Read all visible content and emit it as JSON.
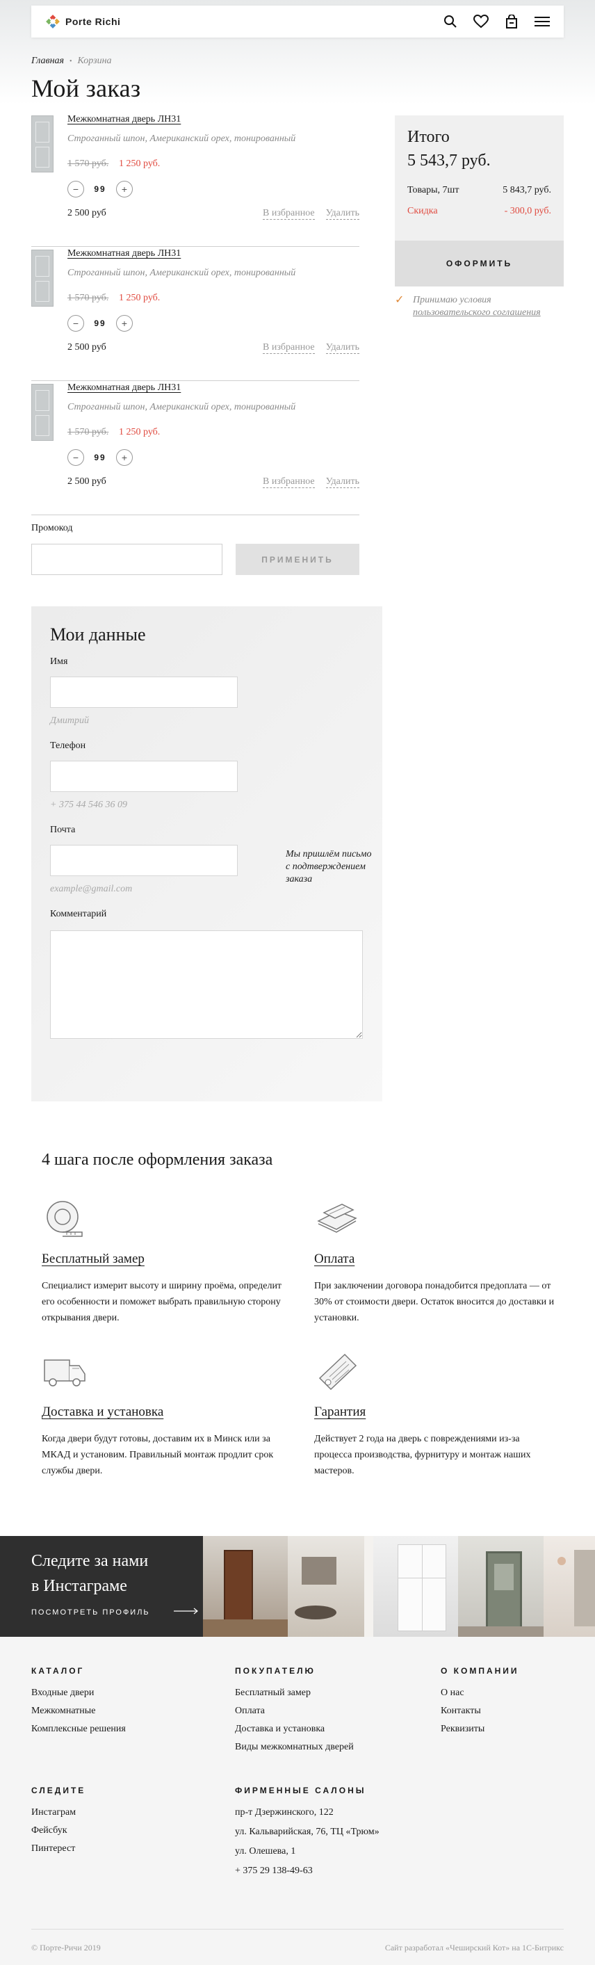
{
  "header": {
    "logo_text": "Porte Richi",
    "icons": [
      "search-icon",
      "heart-icon",
      "bag-icon",
      "menu-icon"
    ]
  },
  "breadcrumb": {
    "home": "Главная",
    "current": "Корзина"
  },
  "page_title": "Мой заказ",
  "cart": {
    "items": [
      {
        "title": "Межкомнатная дверь ЛН31",
        "description": "Строганный шпон, Американский орех, тонированный",
        "old_price": "1 570 руб.",
        "new_price": "1 250 руб.",
        "minus": "−",
        "quantity": "99",
        "plus": "+",
        "total": "2 500 руб",
        "favorite_label": "В избранное",
        "delete_label": "Удалить"
      },
      {
        "title": "Межкомнатная дверь ЛН31",
        "description": "Строганный шпон, Американский орех, тонированный",
        "old_price": "1 570 руб.",
        "new_price": "1 250 руб.",
        "minus": "−",
        "quantity": "99",
        "plus": "+",
        "total": "2 500 руб",
        "favorite_label": "В избранное",
        "delete_label": "Удалить"
      },
      {
        "title": "Межкомнатная дверь ЛН31",
        "description": "Строганный шпон, Американский орех, тонированный",
        "old_price": "1 570 руб.",
        "new_price": "1 250 руб.",
        "minus": "−",
        "quantity": "99",
        "plus": "+",
        "total": "2 500 руб",
        "favorite_label": "В избранное",
        "delete_label": "Удалить"
      }
    ]
  },
  "summary": {
    "title": "Итого",
    "total": "5 543,7 руб.",
    "goods_label": "Товары, 7шт",
    "goods_value": "5 843,7 руб.",
    "discount_label": "Скидка",
    "discount_value": "- 300,0 руб.",
    "checkout_label": "ОФОРМИТЬ",
    "terms_text": "Принимаю условия",
    "terms_link": "пользовательского соглашения"
  },
  "promo": {
    "label": "Промокод",
    "value": "",
    "apply_label": "ПРИМЕНИТЬ"
  },
  "my_data": {
    "title": "Мои данные",
    "name_label": "Имя",
    "name_value": "",
    "name_hint": "Дмитрий",
    "phone_label": "Телефон",
    "phone_value": "",
    "phone_hint": "+ 375 44 546 36 09",
    "email_label": "Почта",
    "email_value": "",
    "email_hint": "example@gmail.com",
    "email_note_line1": "Мы пришлём письмо",
    "email_note_line2": "с подтверждением заказа",
    "comment_label": "Комментарий",
    "comment_value": ""
  },
  "steps": {
    "title": "4 шага после оформления заказа",
    "items": [
      {
        "icon": "tape-measure-icon",
        "title": "Бесплатный замер",
        "text": "Специалист измерит высоту и ширину проёма, определит его особенности и поможет выбрать правильную сторону открывания двери."
      },
      {
        "icon": "payment-icon",
        "title": "Оплата",
        "text": "При заключении договора  понадобится предоплата — от 30% от стоимости двери. Остаток вносится до доставки и установки."
      },
      {
        "icon": "delivery-van-icon",
        "title": "Доставка и установка",
        "text": "Когда двери будут готовы, доставим их в Минск или за МКАД и установим. Правильный монтаж продлит срок службы двери."
      },
      {
        "icon": "warranty-document-icon",
        "title": "Гарантия",
        "text": "Действует 2 года на дверь с повреждениями из-за процесса производства, фурнитуру и монтаж наших мастеров."
      }
    ]
  },
  "instagram": {
    "title_line1": "Следите за нами",
    "title_line2": "в Инстаграме",
    "link_label": "ПОСМОТРЕТЬ ПРОФИЛЬ"
  },
  "footer": {
    "catalog": {
      "heading": "КАТАЛОГ",
      "links": [
        "Входные двери",
        "Межкомнатные",
        "Комплексные решения"
      ]
    },
    "buyer": {
      "heading": "ПОКУПАТЕЛЮ",
      "links": [
        "Бесплатный замер",
        "Оплата",
        "Доставка и установка",
        "Виды межкомнатных дверей"
      ]
    },
    "company": {
      "heading": "О КОМПАНИИ",
      "links": [
        "О нас",
        "Контакты",
        "Реквизиты"
      ]
    },
    "follow": {
      "heading": "СЛЕДИТЕ",
      "links": [
        "Инстаграм",
        "Фейсбук",
        "Пинтерест"
      ]
    },
    "salons": {
      "heading": "ФИРМЕННЫЕ САЛОНЫ",
      "addresses": [
        "пр-т Дзержинского, 122",
        "ул. Кальварийская, 76, ТЦ «Трюм»",
        "ул. Олешева, 1"
      ],
      "phone": "+ 375 29 138-49-63"
    },
    "copyright": "© Порте-Ричи 2019",
    "developer": "Сайт разработал «Чеширский Кот» на 1С-Битрикс"
  },
  "colors": {
    "accent_red": "#e04a3f",
    "check_orange": "#e08a3a",
    "instagram_card": "#2f2f2f"
  }
}
